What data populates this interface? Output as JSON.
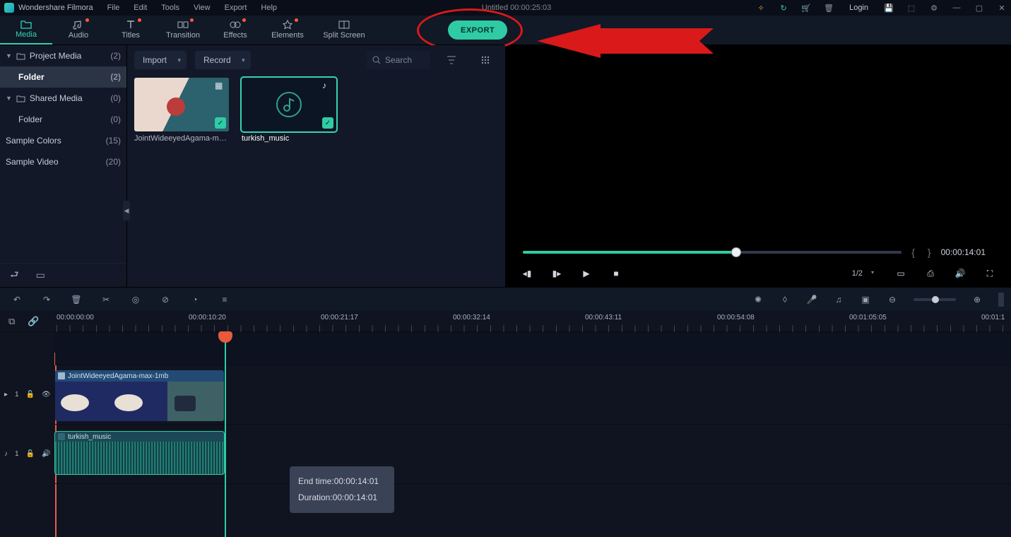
{
  "titlebar": {
    "appname": "Wondershare Filmora",
    "menus": [
      "File",
      "Edit",
      "Tools",
      "View",
      "Export",
      "Help"
    ],
    "center": "Untitled  00:00:25:03",
    "login": "Login"
  },
  "tooltabs": [
    {
      "label": "Media",
      "dot": false,
      "active": true
    },
    {
      "label": "Audio",
      "dot": true,
      "active": false
    },
    {
      "label": "Titles",
      "dot": true,
      "active": false
    },
    {
      "label": "Transition",
      "dot": true,
      "active": false
    },
    {
      "label": "Effects",
      "dot": true,
      "active": false
    },
    {
      "label": "Elements",
      "dot": true,
      "active": false
    },
    {
      "label": "Split Screen",
      "dot": false,
      "active": false
    }
  ],
  "export_label": "EXPORT",
  "library": {
    "groups": [
      {
        "name": "Project Media",
        "count": "(2)",
        "expanded": true,
        "children": [
          {
            "name": "Folder",
            "count": "(2)",
            "selected": true
          }
        ]
      },
      {
        "name": "Shared Media",
        "count": "(0)",
        "expanded": true,
        "children": [
          {
            "name": "Folder",
            "count": "(0)",
            "selected": false
          }
        ]
      }
    ],
    "flat": [
      {
        "name": "Sample Colors",
        "count": "(15)"
      },
      {
        "name": "Sample Video",
        "count": "(20)"
      }
    ]
  },
  "centerpanel": {
    "import": "Import",
    "record": "Record",
    "search": "Search",
    "thumbs": [
      {
        "cap": "JointWideeyedAgama-ma...",
        "type": "video",
        "selected": false
      },
      {
        "cap": "turkish_music",
        "type": "audio",
        "selected": true
      }
    ]
  },
  "preview": {
    "time": "00:00:14:01",
    "ratio": "1/2"
  },
  "ruler": [
    "00:00:00:00",
    "00:00:10:20",
    "00:00:21:17",
    "00:00:32:14",
    "00:00:43:11",
    "00:00:54:08",
    "00:01:05:05",
    "00:01:1"
  ],
  "clips": {
    "video": "JointWideeyedAgama-max-1mb",
    "audio": "turkish_music"
  },
  "tooltip": {
    "end_label": "End time:",
    "end_val": "00:00:14:01",
    "dur_label": "Duration:",
    "dur_val": "00:00:14:01"
  },
  "track_gutter": {
    "v": "1",
    "a": "1"
  }
}
